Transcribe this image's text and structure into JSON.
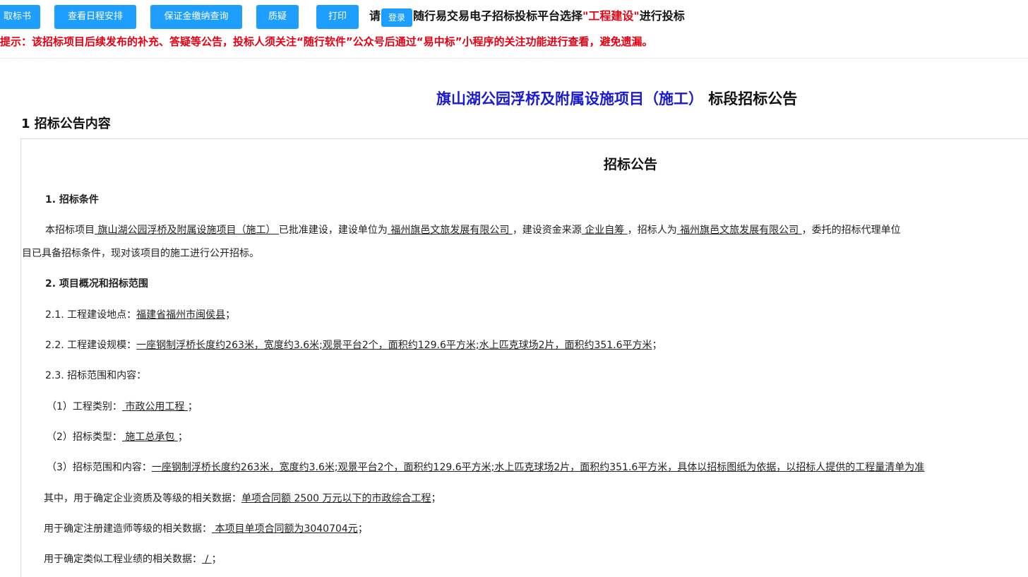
{
  "toolbar": {
    "buttons": [
      "取标书",
      "查看日程安排",
      "保证金缴纳查询",
      "质疑",
      "打印"
    ],
    "login": "登录"
  },
  "topline": {
    "prefix": "请",
    "middle": "随行易交易电子招标投标平台选择",
    "highlight": "\"工程建设\"",
    "suffix": "进行投标"
  },
  "notice": "提示：该招标项目后续发布的补充、答疑等公告，投标人须关注“随行软件”公众号后通过“易中标”小程序的关注功能进行查看，避免遗漏。",
  "title": {
    "project": "旗山湖公园浮桥及附属设施项目（施工）",
    "suffix": " 标段招标公告"
  },
  "section_heading": "1 招标公告内容",
  "doc": {
    "title": "招标公告",
    "h1": "1. 招标条件",
    "p1": {
      "a": "本招标项目",
      "b": " 旗山湖公园浮桥及附属设施项目（施工） ",
      "c": "已批准建设，建设单位为",
      "d": " 福州旗邑文旅发展有限公司 ",
      "e": "，建设资金来源",
      "f": " 企业自筹 ",
      "g": "，招标人为",
      "h": "  福州旗邑文旅发展有限公司 ",
      "i": "，委托的招标代理单位"
    },
    "p1_cont": "目已具备招标条件，现对该项目的施工进行公开招标。",
    "h2": "2. 项目概况和招标范围",
    "l21": {
      "label": "2.1. 工程建设地点：",
      "value": "福建省福州市闽侯县",
      "end": "；"
    },
    "l22": {
      "label": "2.2. 工程建设规模：",
      "value": "一座钢制浮桥长度约263米，宽度约3.6米;观景平台2个，面积约129.6平方米;水上匹克球场2片，面积约351.6平方米",
      "end": "；"
    },
    "l23": "2.3. 招标范围和内容：",
    "s1": {
      "label": "（1）工程类别：",
      "value": " 市政公用工程 ",
      "end": "；"
    },
    "s2": {
      "label": "（2）招标类型：",
      "value": " 施工总承包 ",
      "end": "；"
    },
    "s3": {
      "label": "（3）招标范围和内容：",
      "value": "一座钢制浮桥长度约263米，宽度约3.6米;观景平台2个，面积约129.6平方米;水上匹克球场2片，面积约351.6平方米，具体以招标图纸为依据，以招标人提供的工程量清单为准"
    },
    "q1": {
      "label": "其中，用于确定企业资质及等级的相关数据：",
      "value": "单项合同额 2500 万元以下的市政综合工程",
      "end": "；"
    },
    "q2": {
      "label": "用于确定注册建造师等级的相关数据：",
      "value": "  本项目单项合同额为3040704元",
      "end": "；"
    },
    "q3": {
      "label": "用于确定类似工程业绩的相关数据：",
      "value": "  /  ",
      "end": "；"
    }
  }
}
